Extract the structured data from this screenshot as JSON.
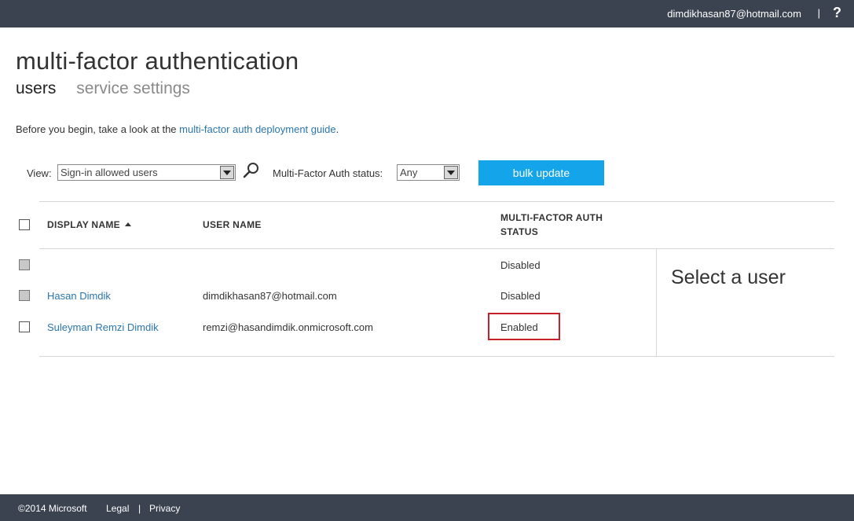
{
  "topbar": {
    "account": "dimdikhasan87@hotmail.com",
    "separator": "|",
    "help": "?"
  },
  "page": {
    "title": "multi-factor authentication",
    "tabs": [
      {
        "label": "users",
        "active": true
      },
      {
        "label": "service settings",
        "active": false
      }
    ],
    "intro_text": "Before you begin, take a look at the ",
    "intro_link": "multi-factor auth deployment guide",
    "intro_end": "."
  },
  "filters": {
    "view_label": "View:",
    "view_value": "Sign-in allowed users",
    "status_label": "Multi-Factor Auth status:",
    "status_value": "Any",
    "bulk_update": "bulk update"
  },
  "table": {
    "headers": {
      "display_name": "DISPLAY NAME",
      "user_name": "USER NAME",
      "mfa_status_line1": "MULTI-FACTOR AUTH",
      "mfa_status_line2": "STATUS"
    },
    "rows": [
      {
        "display_name": "",
        "user_name": "",
        "status": "Disabled",
        "checkbox": "gray"
      },
      {
        "display_name": "Hasan Dimdik",
        "user_name": "dimdikhasan87@hotmail.com",
        "status": "Disabled",
        "checkbox": "gray"
      },
      {
        "display_name": "Suleyman Remzi Dimdik",
        "user_name": "remzi@hasandimdik.onmicrosoft.com",
        "status": "Enabled",
        "checkbox": "white"
      }
    ]
  },
  "detail_panel": {
    "placeholder": "Select a user"
  },
  "footer": {
    "copyright": "©2014 Microsoft",
    "legal": "Legal",
    "separator": "|",
    "privacy": "Privacy"
  },
  "colors": {
    "topbar": "#3b4350",
    "accent_button": "#14a4ea",
    "link": "#2a76ae",
    "highlight_border": "#c8202a"
  }
}
